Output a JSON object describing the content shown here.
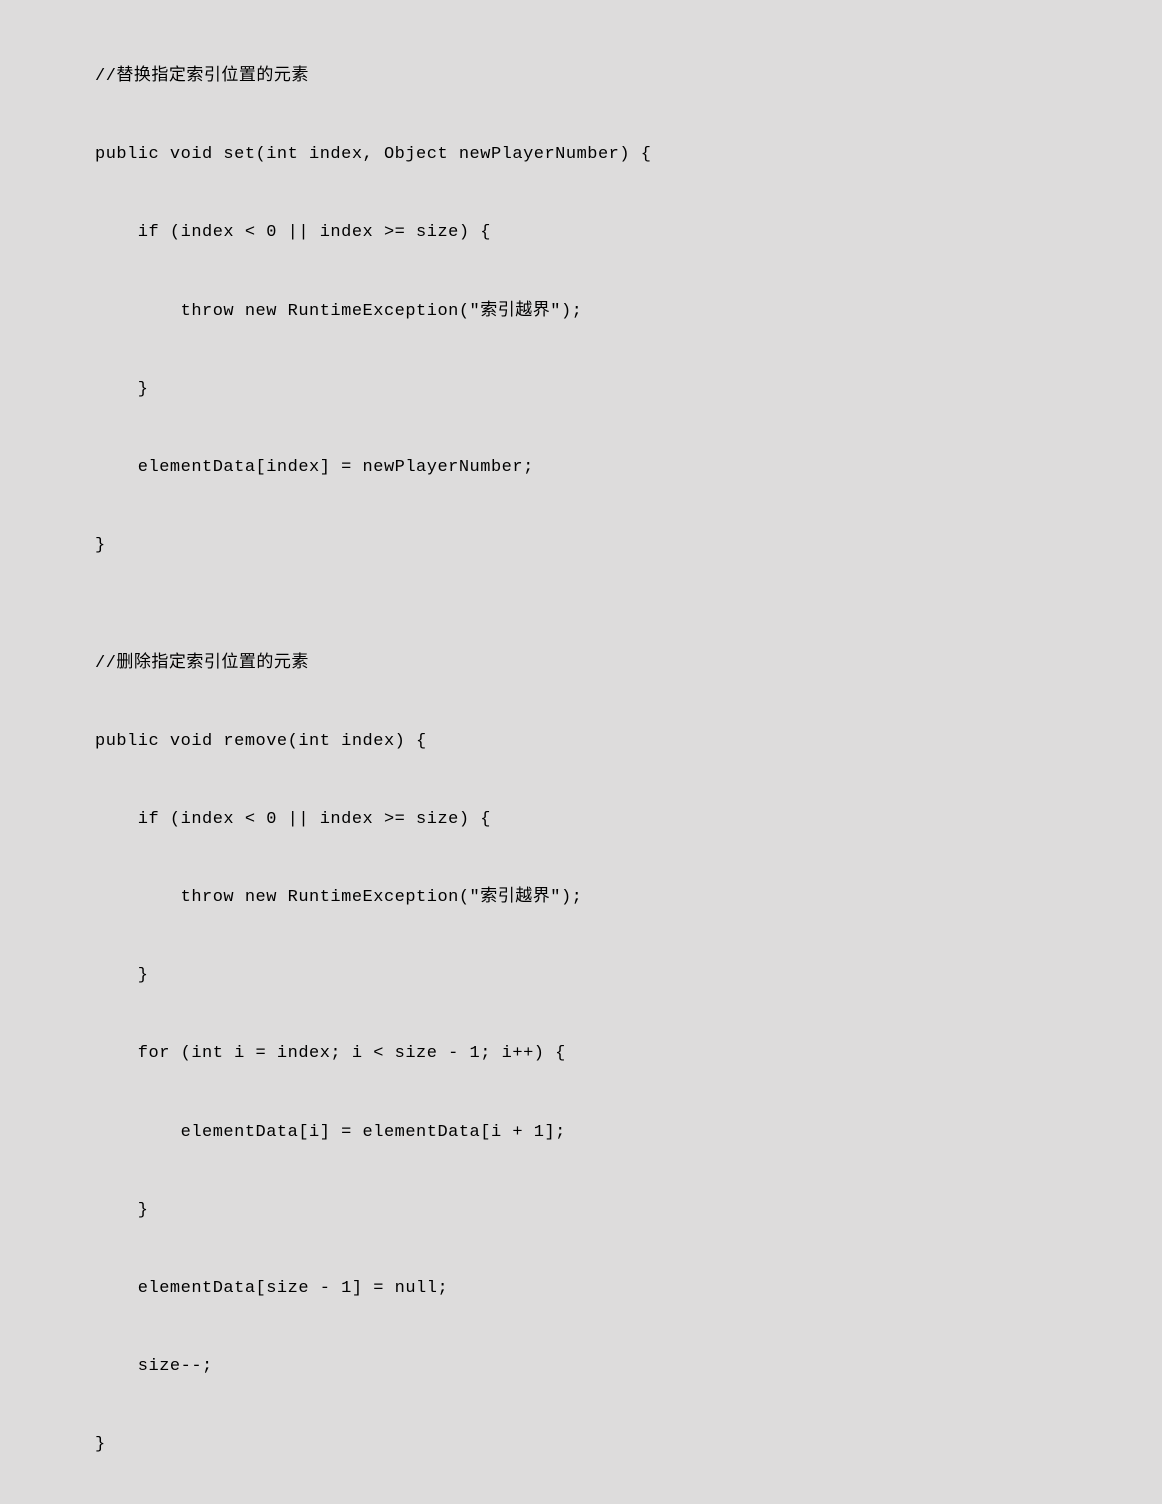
{
  "code": {
    "l1": "//替换指定索引位置的元素",
    "l2": "public void set(int index, Object newPlayerNumber) {",
    "l3": "    if (index < 0 || index >= size) {",
    "l4": "        throw new RuntimeException(\"索引越界\");",
    "l5": "    }",
    "l6": "    elementData[index] = newPlayerNumber;",
    "l7": "}",
    "l8": "",
    "l9": "//删除指定索引位置的元素",
    "l10": "public void remove(int index) {",
    "l11": "    if (index < 0 || index >= size) {",
    "l12": "        throw new RuntimeException(\"索引越界\");",
    "l13": "    }",
    "l14": "    for (int i = index; i < size - 1; i++) {",
    "l15": "        elementData[i] = elementData[i + 1];",
    "l16": "    }",
    "l17": "    elementData[size - 1] = null;",
    "l18": "    size--;",
    "l19": "}"
  }
}
